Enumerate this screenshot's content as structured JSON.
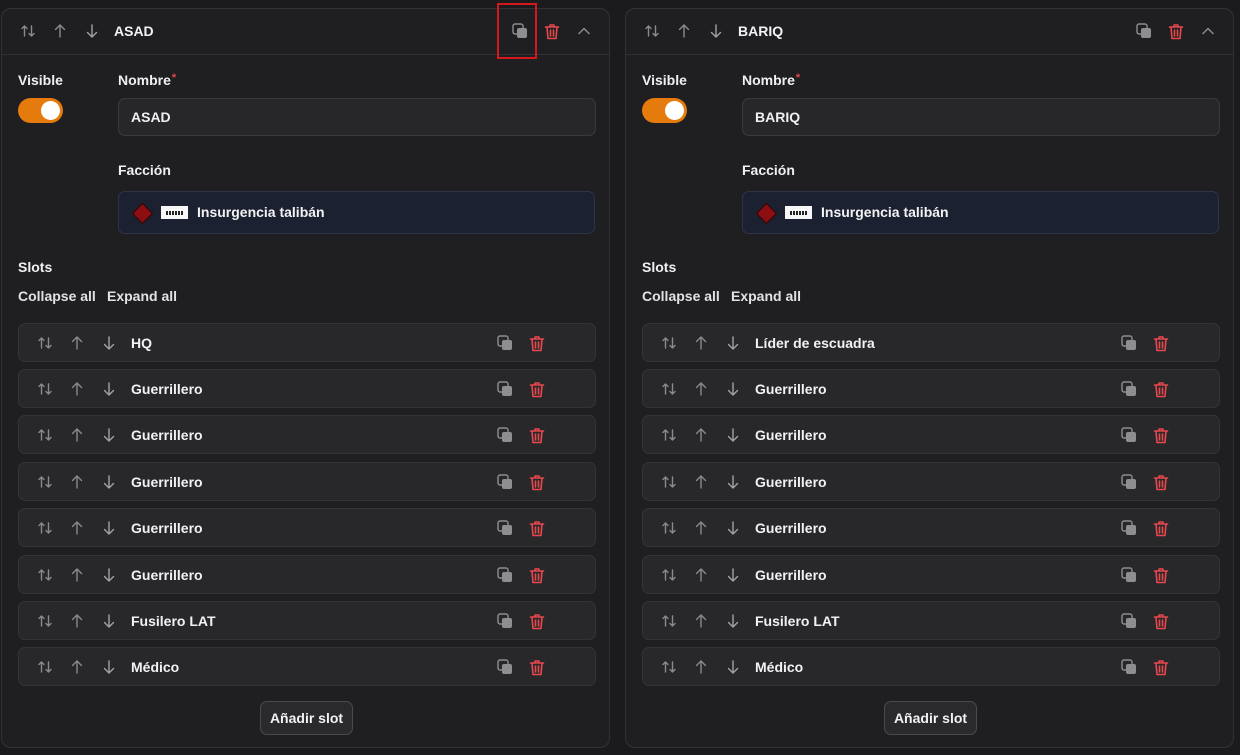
{
  "panels": [
    {
      "title": "ASAD",
      "visible_label": "Visible",
      "visible_on": true,
      "name_label": "Nombre",
      "name_required": "*",
      "name_value": "ASAD",
      "faction_label": "Facción",
      "faction_value": "Insurgencia talibán",
      "slots_label": "Slots",
      "collapse_all": "Collapse all",
      "expand_all": "Expand all",
      "slots": [
        "HQ",
        "Guerrillero",
        "Guerrillero",
        "Guerrillero",
        "Guerrillero",
        "Guerrillero",
        "Fusilero LAT",
        "Médico"
      ],
      "add_slot": "Añadir slot"
    },
    {
      "title": "BARIQ",
      "visible_label": "Visible",
      "visible_on": true,
      "name_label": "Nombre",
      "name_required": "*",
      "name_value": "BARIQ",
      "faction_label": "Facción",
      "faction_value": "Insurgencia talibán",
      "slots_label": "Slots",
      "collapse_all": "Collapse all",
      "expand_all": "Expand all",
      "slots": [
        "Líder de escuadra",
        "Guerrillero",
        "Guerrillero",
        "Guerrillero",
        "Guerrillero",
        "Guerrillero",
        "Fusilero LAT",
        "Médico"
      ],
      "add_slot": "Añadir slot"
    }
  ],
  "icons": {
    "reorder": "sort-arrows-icon",
    "move_up": "arrow-up-icon",
    "move_down": "arrow-down-icon",
    "duplicate": "copy-icon",
    "delete": "trash-icon",
    "collapse": "chevron-up-icon"
  },
  "colors": {
    "toggle_on": "#e57b0c",
    "delete_red": "#e5484d",
    "highlight": "#d4191e",
    "faction_diamond": "#8c0d12"
  }
}
